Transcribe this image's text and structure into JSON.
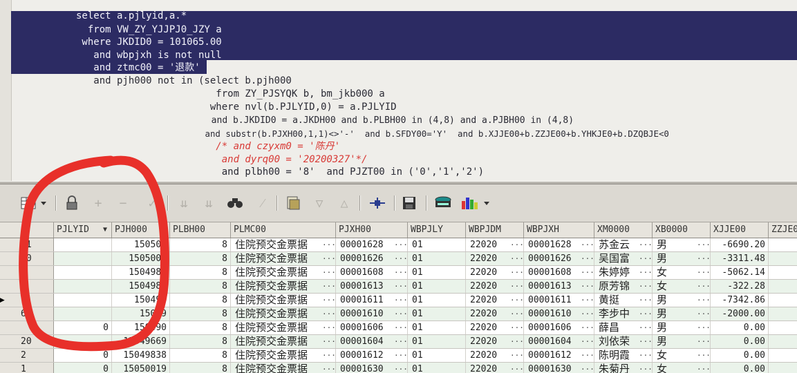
{
  "editor": {
    "lines": [
      "select a.pjlyid,a.*",
      "  from VW_ZY_YJJPJ0_JZY a",
      " where JKDID0 = 101065.00",
      "   and wbpjxh is not null",
      "   and ztmc00 = '退款'",
      "   and pjh000 not in (select b.pjh000",
      "                        from ZY_PJSYQK b, bm_jkb000 a",
      "                       where nvl(b.PJLYID,0) = a.PJLYID",
      "                         and b.JKDID0 = a.JKDH00 and b.PLBH00 in (4,8) and a.PJBH00 in (4,8)",
      "                         and substr(b.PJXH00,1,1)<>'-'  and b.SFDY00='Y'  and b.XJJE00+b.ZZJE00+b.YHKJE0+b.DZQBJE<0",
      "                        /* and czyxm0 = '陈丹'",
      "                         and dyrq00 = '20200327'*/",
      "                         and plbh00 = '8'  and PJZT00 in ('0','1','2')"
    ]
  },
  "toolbar": {
    "icons": [
      "grid-menu-icon",
      "lock-icon",
      "insert-record-icon",
      "delete-record-icon",
      "post-icon",
      "next-record-icon",
      "last-record-icon",
      "find-icon",
      "clear-icon",
      "query-by-example-icon",
      "filter-icon",
      "sort-icon",
      "explain-plan-icon",
      "save-icon",
      "print-icon",
      "chart-icon"
    ]
  },
  "grid": {
    "columns": [
      "PJLYID",
      "PJH000",
      "PLBH00",
      "PLMC00",
      "PJXH00",
      "WBPJLY",
      "WBPJDM",
      "WBPJXH",
      "XM0000",
      "XB0000",
      "XJJE00",
      "ZZJE0"
    ],
    "current_row_marker": "▶",
    "rows": [
      {
        "idx": "11",
        "pjlyid": "",
        "pjh": "150500",
        "plbh": "8",
        "plmc": "住院预交金票据",
        "pjxh": "00001628",
        "wbpjly": "01",
        "wbpjdm": "22020",
        "wbpjxh": "00001628",
        "xm": "苏金云",
        "xb": "男",
        "xjje": "-6690.20"
      },
      {
        "idx": "10",
        "pjlyid": "",
        "pjh": "1505004",
        "plbh": "8",
        "plmc": "住院预交金票据",
        "pjxh": "00001626",
        "wbpjly": "01",
        "wbpjdm": "22020",
        "wbpjxh": "00001626",
        "xm": "吴国富",
        "xb": "男",
        "xjje": "-3311.48"
      },
      {
        "idx": "5",
        "pjlyid": "",
        "pjh": "1504980",
        "plbh": "8",
        "plmc": "住院预交金票据",
        "pjxh": "00001608",
        "wbpjly": "01",
        "wbpjdm": "22020",
        "wbpjxh": "00001608",
        "xm": "朱婷婷",
        "xb": "女",
        "xjje": "-5062.14"
      },
      {
        "idx": "8",
        "pjlyid": "",
        "pjh": "1504988",
        "plbh": "8",
        "plmc": "住院预交金票据",
        "pjxh": "00001613",
        "wbpjly": "01",
        "wbpjdm": "22020",
        "wbpjxh": "00001613",
        "xm": "原芳锦",
        "xb": "女",
        "xjje": "-322.28"
      },
      {
        "idx": "7",
        "pjlyid": "",
        "pjh": "150498",
        "plbh": "8",
        "plmc": "住院预交金票据",
        "pjxh": "00001611",
        "wbpjly": "01",
        "wbpjdm": "22020",
        "wbpjxh": "00001611",
        "xm": "黄挺",
        "xb": "男",
        "xjje": "-7342.86"
      },
      {
        "idx": "6",
        "pjlyid": "",
        "pjh": "15049",
        "plbh": "8",
        "plmc": "住院预交金票据",
        "pjxh": "00001610",
        "wbpjly": "01",
        "wbpjdm": "22020",
        "wbpjxh": "00001610",
        "xm": "李步中",
        "xb": "男",
        "xjje": "-2000.00"
      },
      {
        "idx": "",
        "pjlyid": "0",
        "pjh": "150490",
        "plbh": "8",
        "plmc": "住院预交金票据",
        "pjxh": "00001606",
        "wbpjly": "01",
        "wbpjdm": "22020",
        "wbpjxh": "00001606",
        "xm": "薛昌",
        "xb": "男",
        "xjje": "0.00"
      },
      {
        "idx": "20",
        "pjlyid": "",
        "pjh": "15049669",
        "plbh": "8",
        "plmc": "住院预交金票据",
        "pjxh": "00001604",
        "wbpjly": "01",
        "wbpjdm": "22020",
        "wbpjxh": "00001604",
        "xm": "刘依荣",
        "xb": "男",
        "xjje": "0.00"
      },
      {
        "idx": "2",
        "pjlyid": "0",
        "pjh": "15049838",
        "plbh": "8",
        "plmc": "住院预交金票据",
        "pjxh": "00001612",
        "wbpjly": "01",
        "wbpjdm": "22020",
        "wbpjxh": "00001612",
        "xm": "陈明霞",
        "xb": "女",
        "xjje": "0.00"
      },
      {
        "idx": "1",
        "pjlyid": "0",
        "pjh": "15050019",
        "plbh": "8",
        "plmc": "住院预交金票据",
        "pjxh": "00001630",
        "wbpjly": "01",
        "wbpjdm": "22020",
        "wbpjxh": "00001630",
        "xm": "朱菊丹",
        "xb": "女",
        "xjje": "0.00"
      }
    ]
  },
  "colors": {
    "selection": "#2c2b63",
    "comment": "#d83a36",
    "annotation": "#e8302a",
    "row_alt": "#eaf3ea"
  }
}
